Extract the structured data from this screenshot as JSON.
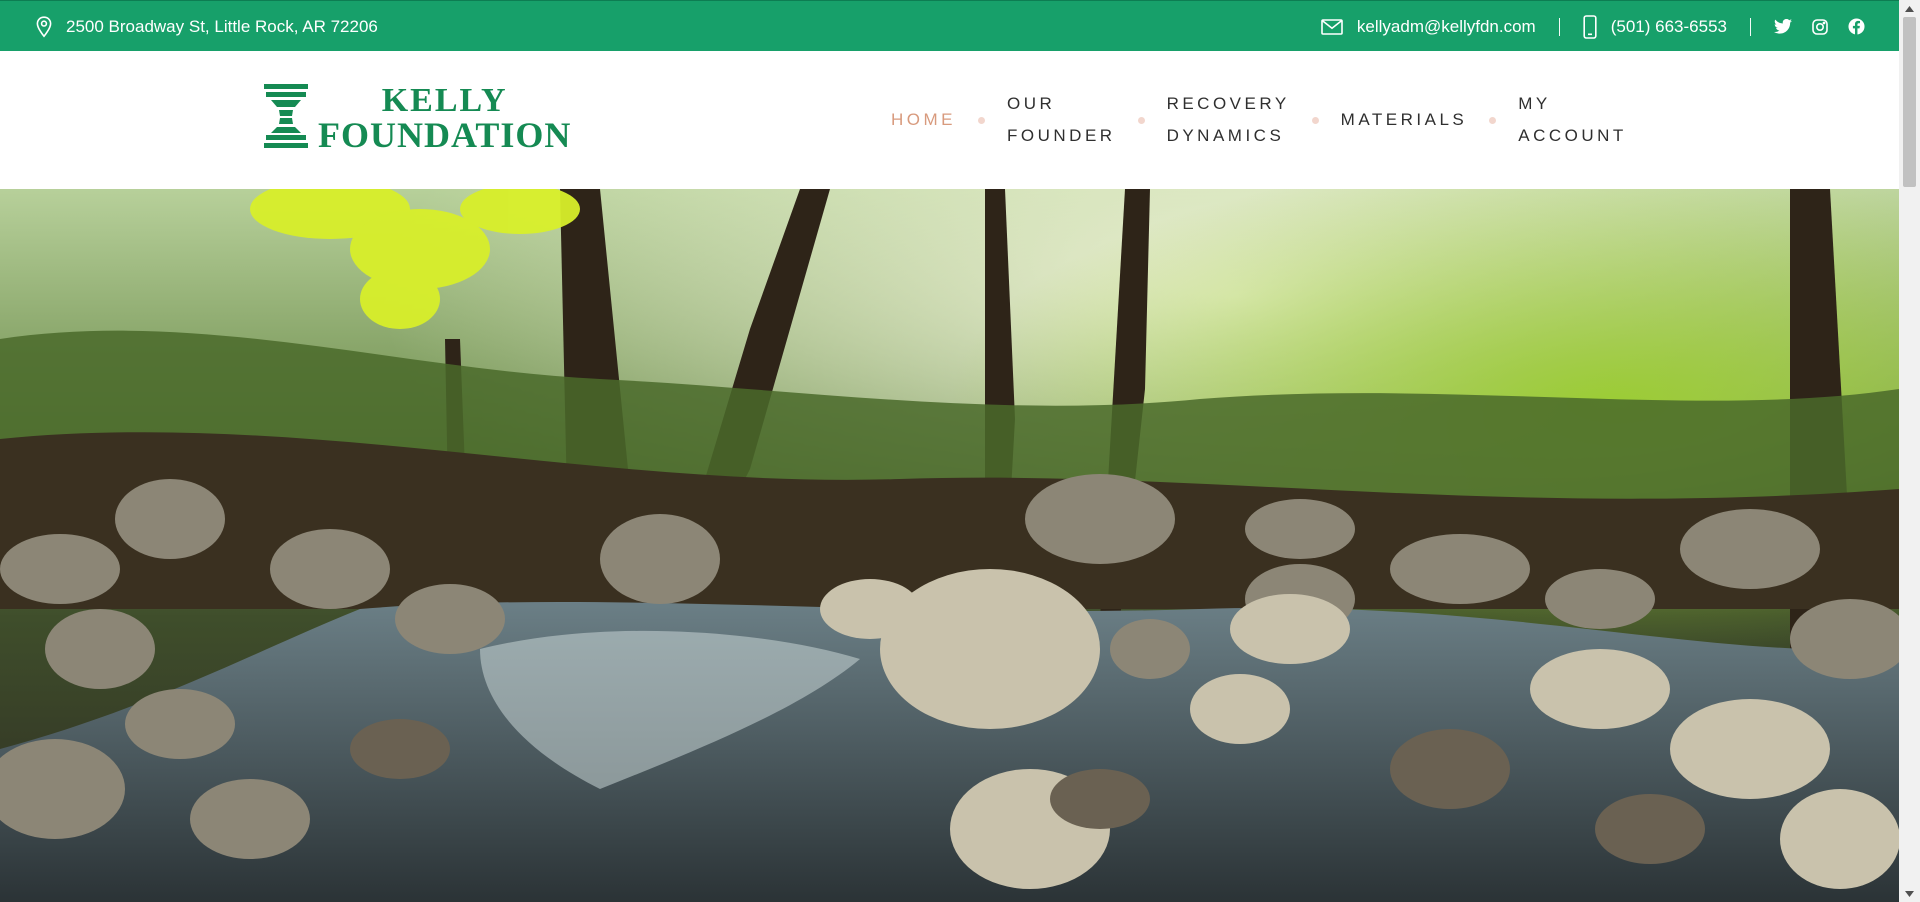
{
  "topbar": {
    "address": "2500 Broadway St, Little Rock, AR 72206",
    "email": "kellyadm@kellyfdn.com",
    "phone": "(501) 663-6553",
    "social_icons": [
      "twitter-icon",
      "instagram-icon",
      "facebook-icon"
    ],
    "background": "#17a06a"
  },
  "logo": {
    "line1": "KELLY",
    "line2": "FOUNDATION",
    "color": "#158a53"
  },
  "nav": {
    "items": [
      {
        "label": "HOME",
        "active": true
      },
      {
        "label": "OUR\nFOUNDER",
        "active": false
      },
      {
        "label": "RECOVERY\nDYNAMICS",
        "active": false
      },
      {
        "label": "MATERIALS",
        "active": false
      },
      {
        "label": "MY\nACCOUNT",
        "active": false
      }
    ],
    "active_color": "#d89a7d"
  },
  "hero": {
    "image": "forest stream with rocks"
  }
}
